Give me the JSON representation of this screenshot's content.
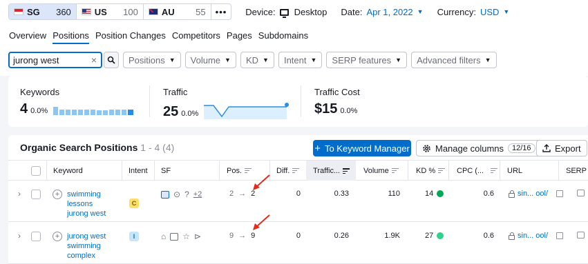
{
  "databases": [
    {
      "code": "SG",
      "count": "360",
      "flag": "sg",
      "active": true
    },
    {
      "code": "US",
      "count": "100",
      "flag": "us",
      "active": false
    },
    {
      "code": "AU",
      "count": "55",
      "flag": "au",
      "active": false
    }
  ],
  "more_label": "•••",
  "device": {
    "label": "Device:",
    "value": "Desktop",
    "icon": "monitor-icon"
  },
  "date": {
    "label": "Date:",
    "value": "Apr 1, 2022"
  },
  "currency": {
    "label": "Currency:",
    "value": "USD"
  },
  "tabs": [
    "Overview",
    "Positions",
    "Position Changes",
    "Competitors",
    "Pages",
    "Subdomains"
  ],
  "active_tab": "Positions",
  "search": {
    "value": "jurong west",
    "clear": "×"
  },
  "filters": [
    "Positions",
    "Volume",
    "KD",
    "Intent",
    "SERP features",
    "Advanced filters"
  ],
  "summary": {
    "keywords": {
      "label": "Keywords",
      "value": "4",
      "change": "0.0%"
    },
    "traffic": {
      "label": "Traffic",
      "value": "25",
      "change": "0.0%"
    },
    "traffic_cost": {
      "label": "Traffic Cost",
      "value": "$15",
      "change": "0.0%"
    }
  },
  "table": {
    "title": "Organic Search Positions",
    "range": "1 - 4 (4)",
    "keyword_manager_button": "To Keyword Manager",
    "manage_columns_button": "Manage columns",
    "columns_badge": "12/16",
    "export_button": "Export",
    "headers": {
      "keyword": "Keyword",
      "intent": "Intent",
      "sf": "SF",
      "pos": "Pos.",
      "diff": "Diff.",
      "traffic": "Traffic...",
      "volume": "Volume",
      "kd": "KD %",
      "cpc": "CPC (...",
      "url": "URL",
      "serp": "SERP"
    },
    "rows": [
      {
        "keyword_lines": [
          "swimming",
          "lessons",
          "jurong west"
        ],
        "intent": "C",
        "sf_more": "+2",
        "pos_from": "2",
        "pos_to": "2",
        "diff": "0",
        "traffic": "0.33",
        "volume": "110",
        "kd": "14",
        "kd_color": "#00a85a",
        "cpc": "0.6",
        "url": "sin... ool/"
      },
      {
        "keyword_lines": [
          "jurong west",
          "swimming",
          "complex"
        ],
        "intent": "I",
        "sf_more": "",
        "pos_from": "9",
        "pos_to": "9",
        "diff": "0",
        "traffic": "0.26",
        "volume": "1.9K",
        "kd": "27",
        "kd_color": "#2fd18c",
        "cpc": "0.6",
        "url": "sin... ool/"
      }
    ]
  },
  "colors": {
    "accent": "#006dca",
    "annotation_arrow": "#e32a1b"
  }
}
